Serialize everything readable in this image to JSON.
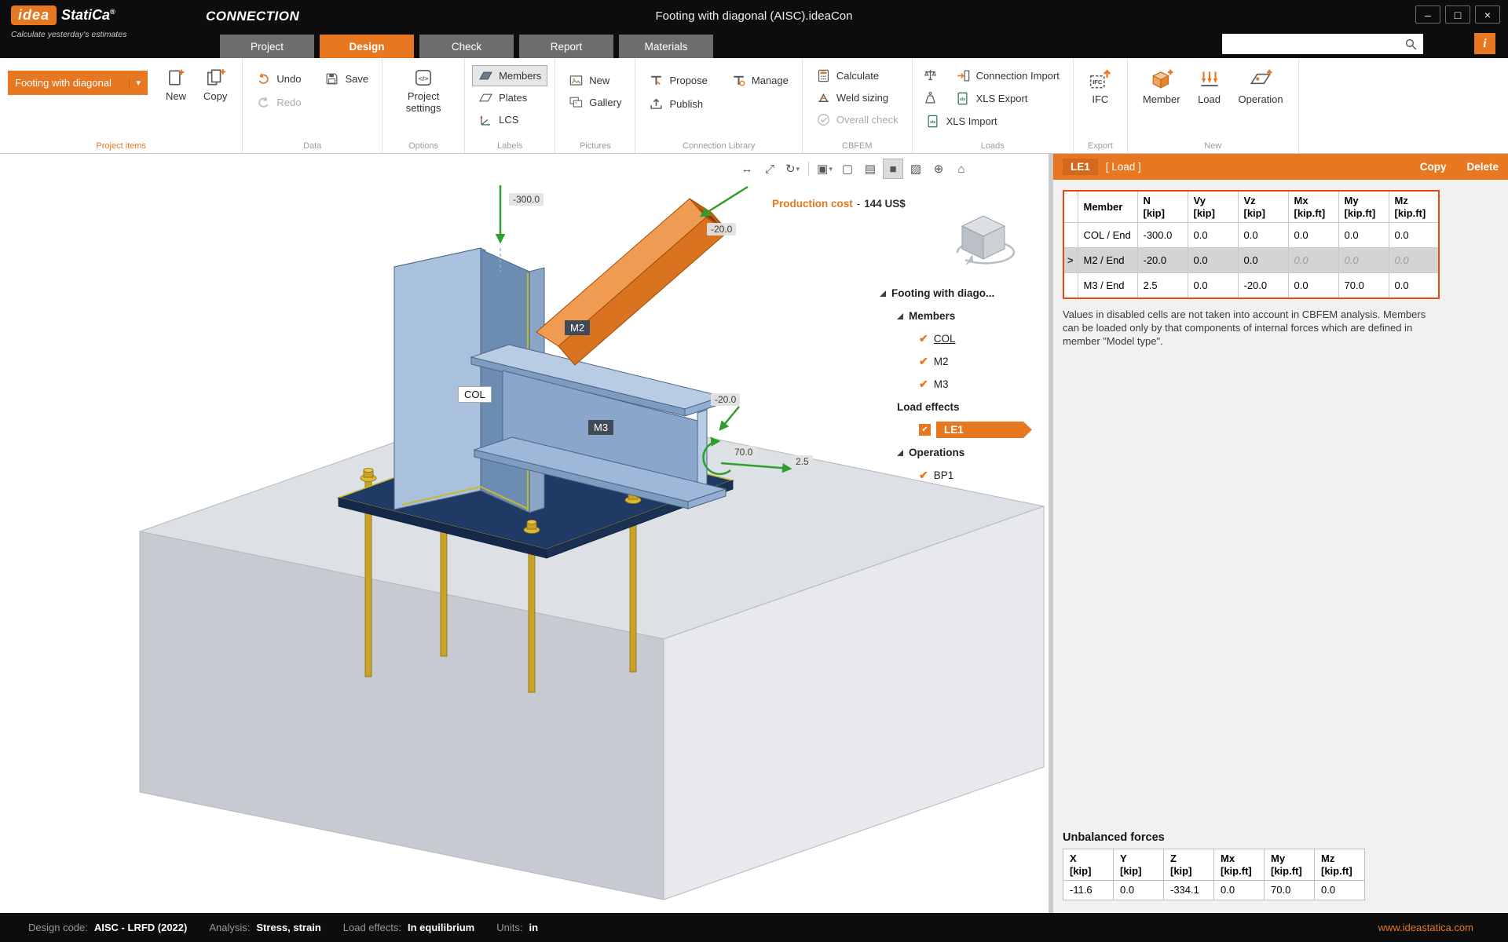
{
  "titlebar": {
    "logo_text_1": "idea",
    "logo_text_2": "StatiCa",
    "logo_reg": "®",
    "tagline": "Calculate yesterday's estimates",
    "product": "CONNECTION",
    "document_title": "Footing with diagonal (AISC).ideaCon"
  },
  "icons": {
    "minimize": "–",
    "maximize": "□",
    "close": "×",
    "caret_down": "▾",
    "check": "✔",
    "row_selector": ">",
    "info": "i"
  },
  "tabs": {
    "project": "Project",
    "design": "Design",
    "check": "Check",
    "report": "Report",
    "materials": "Materials"
  },
  "ribbon": {
    "project_items": {
      "selector_value": "Footing with diagonal",
      "new": "New",
      "copy": "Copy",
      "group": "Project items"
    },
    "data": {
      "undo": "Undo",
      "save": "Save",
      "redo": "Redo",
      "group": "Data"
    },
    "options": {
      "settings": "Project settings",
      "group": "Options"
    },
    "labels": {
      "members": "Members",
      "plates": "Plates",
      "lcs": "LCS",
      "group": "Labels"
    },
    "pictures": {
      "new": "New",
      "gallery": "Gallery",
      "group": "Pictures"
    },
    "connection_library": {
      "propose": "Propose",
      "manage": "Manage",
      "publish": "Publish",
      "group": "Connection Library"
    },
    "cbfem": {
      "calculate": "Calculate",
      "weld_sizing": "Weld sizing",
      "overall_check": "Overall check",
      "group": "CBFEM"
    },
    "loads": {
      "connection_import": "Connection Import",
      "xls_export": "XLS Export",
      "xls_import": "XLS Import",
      "group": "Loads"
    },
    "export": {
      "ifc": "IFC",
      "group": "Export"
    },
    "new": {
      "member": "Member",
      "load": "Load",
      "operation": "Operation",
      "group": "New"
    }
  },
  "viewport_toolbar": {
    "measure": "↔",
    "zoom_fit": "⤢",
    "rotate": "↻",
    "section": "▣",
    "wireframe": "▢",
    "hidden_lines": "▤",
    "shaded": "■",
    "transparent": "▨",
    "origin": "⊕",
    "home": "⌂"
  },
  "viewport": {
    "production_cost_label": "Production cost",
    "production_cost_sep": "-",
    "production_cost_value": "144 US$",
    "labels": {
      "col": "COL",
      "m2": "M2",
      "m3": "M3"
    },
    "loads": {
      "col_n": "-300.0",
      "m2_n": "-20.0",
      "m3_vz": "-20.0",
      "m3_my": "70.0",
      "m3_n": "2.5"
    }
  },
  "tree": {
    "root": "Footing with diago...",
    "members": "Members",
    "col": "COL",
    "m2": "M2",
    "m3": "M3",
    "load_effects": "Load effects",
    "le1": "LE1",
    "operations": "Operations",
    "bp1": "BP1"
  },
  "load_panel": {
    "title": "LE1",
    "type": "[ Load ]",
    "copy": "Copy",
    "delete": "Delete",
    "table": {
      "member_header": "Member",
      "columns": [
        {
          "name": "N",
          "unit": "[kip]"
        },
        {
          "name": "Vy",
          "unit": "[kip]"
        },
        {
          "name": "Vz",
          "unit": "[kip]"
        },
        {
          "name": "Mx",
          "unit": "[kip.ft]"
        },
        {
          "name": "My",
          "unit": "[kip.ft]"
        },
        {
          "name": "Mz",
          "unit": "[kip.ft]"
        }
      ],
      "rows": [
        {
          "member": "COL / End",
          "v": [
            "-300.0",
            "0.0",
            "0.0",
            "0.0",
            "0.0",
            "0.0"
          ]
        },
        {
          "member": "M2 / End",
          "v": [
            "-20.0",
            "0.0",
            "0.0",
            "0.0",
            "0.0",
            "0.0"
          ]
        },
        {
          "member": "M3 / End",
          "v": [
            "2.5",
            "0.0",
            "-20.0",
            "0.0",
            "70.0",
            "0.0"
          ]
        }
      ]
    },
    "note": "Values in disabled cells are not taken into account in CBFEM analysis. Members can be loaded only by that components of internal forces which are defined in member \"Model type\".",
    "unbalanced": {
      "title": "Unbalanced forces",
      "columns": [
        {
          "name": "X",
          "unit": "[kip]"
        },
        {
          "name": "Y",
          "unit": "[kip]"
        },
        {
          "name": "Z",
          "unit": "[kip]"
        },
        {
          "name": "Mx",
          "unit": "[kip.ft]"
        },
        {
          "name": "My",
          "unit": "[kip.ft]"
        },
        {
          "name": "Mz",
          "unit": "[kip.ft]"
        }
      ],
      "values": [
        "-11.6",
        "0.0",
        "-334.1",
        "0.0",
        "70.0",
        "0.0"
      ]
    }
  },
  "statusbar": {
    "design_code_label": "Design code:",
    "design_code": "AISC - LRFD (2022)",
    "analysis_label": "Analysis:",
    "analysis": "Stress, strain",
    "load_effects_label": "Load effects:",
    "load_effects": "In equilibrium",
    "units_label": "Units:",
    "units": "in",
    "website": "www.ideastatica.com"
  },
  "colors": {
    "accent": "#e87722",
    "table_border": "#e8490f",
    "load_arrow": "#2e9e2e",
    "steel": "#a9c1dd",
    "diagonal": "#e87722",
    "base_plate": "#203a66",
    "anchor_bolt": "#c9a227"
  }
}
